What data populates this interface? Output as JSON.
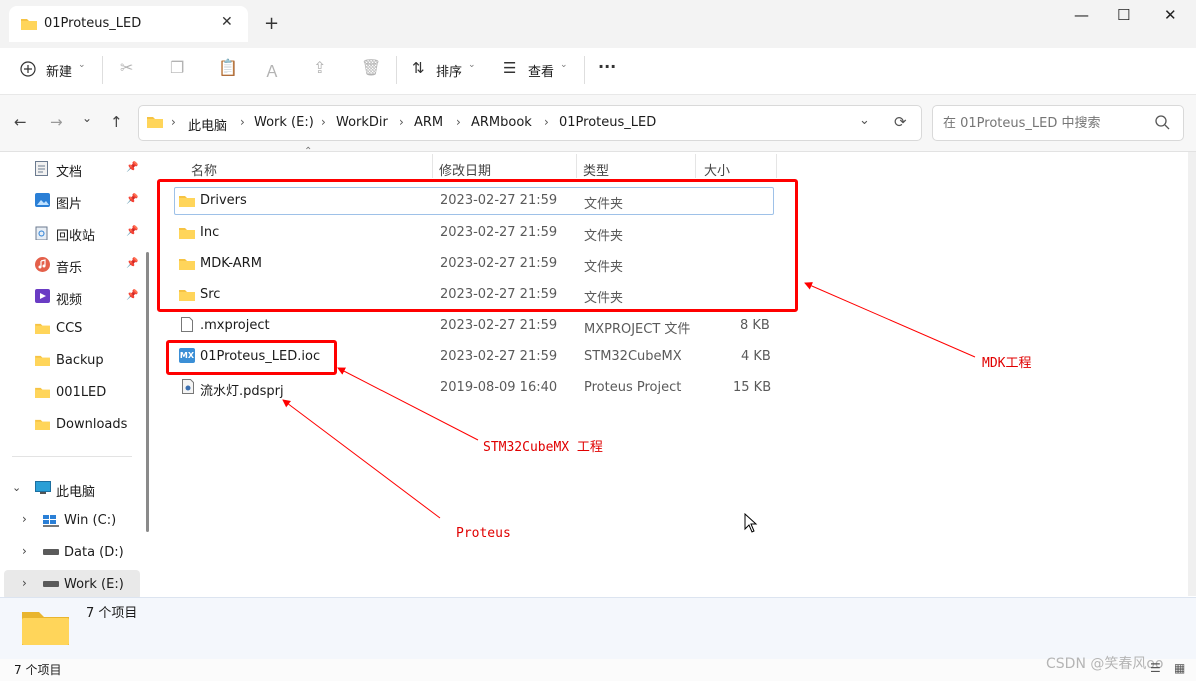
{
  "tab": {
    "title": "01Proteus_LED",
    "close": "✕",
    "new": "+"
  },
  "window": {
    "minimize": "—",
    "maximize": "☐",
    "close": "✕"
  },
  "toolbar": {
    "new_label": "新建",
    "sort_label": "排序",
    "view_label": "查看",
    "more": "···"
  },
  "nav": {
    "back": "←",
    "forward": "→",
    "recent": "⌄",
    "up": "↑",
    "refresh": "⟳",
    "dropdown": "⌄"
  },
  "breadcrumb": [
    "此电脑",
    "Work (E:)",
    "WorkDir",
    "ARM",
    "ARMbook",
    "01Proteus_LED"
  ],
  "search": {
    "placeholder": "在 01Proteus_LED 中搜索"
  },
  "sidebar": {
    "quick": [
      {
        "label": "文档",
        "pinned": true,
        "icon": "documents-icon"
      },
      {
        "label": "图片",
        "pinned": true,
        "icon": "pictures-icon"
      },
      {
        "label": "回收站",
        "pinned": true,
        "icon": "recycle-bin-icon"
      },
      {
        "label": "音乐",
        "pinned": true,
        "icon": "music-icon"
      },
      {
        "label": "视频",
        "pinned": true,
        "icon": "videos-icon"
      },
      {
        "label": "CCS",
        "pinned": false,
        "icon": "folder-icon"
      },
      {
        "label": "Backup",
        "pinned": false,
        "icon": "folder-icon"
      },
      {
        "label": "001LED",
        "pinned": false,
        "icon": "folder-icon"
      },
      {
        "label": "Downloads",
        "pinned": false,
        "icon": "folder-icon"
      }
    ],
    "this_pc": "此电脑",
    "drives": [
      "Win (C:)",
      "Data (D:)",
      "Work (E:)"
    ]
  },
  "columns": {
    "name": "名称",
    "date": "修改日期",
    "type": "类型",
    "size": "大小"
  },
  "files": [
    {
      "name": "Drivers",
      "date": "2023-02-27 21:59",
      "type": "文件夹",
      "size": "",
      "icon": "folder-icon"
    },
    {
      "name": "Inc",
      "date": "2023-02-27 21:59",
      "type": "文件夹",
      "size": "",
      "icon": "folder-icon"
    },
    {
      "name": "MDK-ARM",
      "date": "2023-02-27 21:59",
      "type": "文件夹",
      "size": "",
      "icon": "folder-icon"
    },
    {
      "name": "Src",
      "date": "2023-02-27 21:59",
      "type": "文件夹",
      "size": "",
      "icon": "folder-icon"
    },
    {
      "name": ".mxproject",
      "date": "2023-02-27 21:59",
      "type": "MXPROJECT 文件",
      "size": "8 KB",
      "icon": "file-icon"
    },
    {
      "name": "01Proteus_LED.ioc",
      "date": "2023-02-27 21:59",
      "type": "STM32CubeMX",
      "size": "4 KB",
      "icon": "stm32cubemx-icon"
    },
    {
      "name": "流水灯.pdsprj",
      "date": "2019-08-09 16:40",
      "type": "Proteus Project",
      "size": "15 KB",
      "icon": "proteus-file-icon"
    }
  ],
  "mx_badge": "MX",
  "annotations": {
    "mdk": "MDK工程",
    "cubemx": "STM32CubeMX 工程",
    "proteus": "Proteus"
  },
  "details": {
    "count": "7 个项目"
  },
  "status": {
    "count": "7 个项目"
  },
  "watermark": "CSDN @笑春风oo",
  "colors": {
    "annotation": "#ff0000",
    "folder": "#f6c343",
    "selection": "#cfe3fa"
  }
}
